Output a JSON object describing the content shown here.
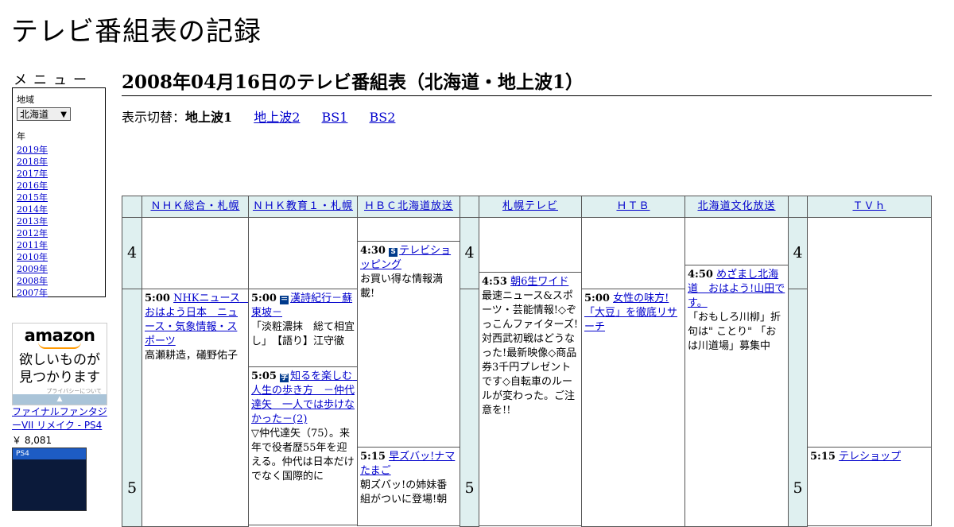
{
  "site_title": "テレビ番組表の記録",
  "menu": {
    "heading": "メニュー",
    "region_label": "地域",
    "region_value": "北海道",
    "year_label": "年",
    "years": [
      "2019年",
      "2018年",
      "2017年",
      "2016年",
      "2015年",
      "2014年",
      "2013年",
      "2012年",
      "2011年",
      "2010年",
      "2009年",
      "2008年",
      "2007年"
    ]
  },
  "ad": {
    "logo": "amazon",
    "tagline_1": "欲しいものが",
    "tagline_2": "見つかります",
    "privacy": "プライバシーについて",
    "product_name": "ファイナルファンタジーVII リメイク - PS4",
    "product_price": "￥ 8,081",
    "product_badge": "PS4"
  },
  "page_title": "2008年04月16日のテレビ番組表（北海道・地上波1）",
  "view_switch": {
    "label": "表示切替：",
    "current": "地上波1",
    "links": [
      "地上波2",
      "BS1",
      "BS2"
    ]
  },
  "channels": [
    "ＮＨＫ総合・札幌",
    "ＮＨＫ教育１・札幌",
    "ＨＢＣ北海道放送",
    "札幌テレビ",
    "ＨＴＢ",
    "北海道文化放送",
    "ＴＶｈ"
  ],
  "hours": [
    "4",
    "5"
  ],
  "programs": [
    {
      "time": "5:00",
      "title": "NHKニュース　おはよう日本　ニュース・気象情報・スポーツ",
      "desc": "高瀬耕造，礒野佑子"
    },
    {
      "time": "5:00",
      "glyph": "＝",
      "title": "漢詩紀行－蘇東坡－",
      "desc": "「淡粧濃抹　総て相宜し」　【語り】江守徹"
    },
    {
      "time": "5:05",
      "glyph": "字",
      "title": "知るを楽しむ　人生の歩き方　－仲代達矢　一人では歩けなかった－(2)",
      "desc": "▽仲代達矢（75）。来年で役者歴55年を迎える。仲代は日本だけでなく国際的に"
    },
    {
      "time": "4:30",
      "glyph": "S",
      "title": "テレビショッピング",
      "desc": "お買い得な情報満載!"
    },
    {
      "time": "5:15",
      "title": "早ズバッ!ナマたまご",
      "desc": "朝ズバッ!の姉妹番組がついに登場!朝"
    },
    {
      "time": "4:53",
      "title": "朝6生ワイド",
      "desc": "最速ニュース&スポーツ・芸能情報!◇ぞっこんファイターズ!対西武初戦はどうなった!最新映像◇商品券3千円プレゼントです◇自転車のルールが変わった。ご注意を!!"
    },
    {
      "time": "5:00",
      "title": "女性の味方!「大豆」を徹底リサーチ",
      "desc": ""
    },
    {
      "time": "4:50",
      "title": "めざまし北海道　おはよう!山田です。",
      "desc": "「おもしろ川柳」折句は\" ことり\" 「おは川道場」募集中"
    },
    {
      "time": "5:15",
      "title": "テレショップ",
      "desc": ""
    }
  ]
}
